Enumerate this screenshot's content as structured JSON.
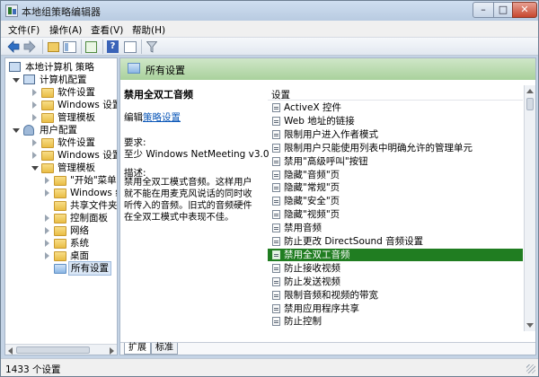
{
  "window": {
    "title": "本地组策略编辑器",
    "controls": {
      "minimize": "–",
      "maximize": "□",
      "close": "✕"
    }
  },
  "menubar": {
    "items": [
      "文件(F)",
      "操作(A)",
      "查看(V)",
      "帮助(H)"
    ]
  },
  "toolbar": {
    "icons": [
      "back-arrow-icon",
      "forward-arrow-icon",
      "up-folder-icon",
      "show-tree-icon",
      "export-list-icon",
      "help-icon",
      "properties-icon",
      "filter-icon"
    ],
    "help_glyph": "?"
  },
  "tree": {
    "root": "本地计算机 策略",
    "computer_config": "计算机配置",
    "computer_children": [
      "软件设置",
      "Windows 设置",
      "管理模板"
    ],
    "user_config": "用户配置",
    "user_children": [
      "软件设置",
      "Windows 设置",
      "管理模板"
    ],
    "admin_templates_children": [
      "\"开始\"菜单和",
      "Windows 组件",
      "共享文件夹",
      "控制面板",
      "网络",
      "系统",
      "桌面",
      "所有设置"
    ],
    "selected": "所有设置"
  },
  "right": {
    "header_title": "所有设置",
    "desc_title": "禁用全双工音频",
    "edit_prefix": "编辑",
    "edit_link": "策略设置",
    "requirements_label": "要求:",
    "requirements_value": "至少 Windows NetMeeting v3.0",
    "description_label": "描述:",
    "description_text": "禁用全双工模式音频。这样用户就不能在用麦克风说话的同时收听传入的音频。旧式的音频硬件在全双工模式中表现不佳。",
    "list_header": "设置",
    "settings": [
      "ActiveX 控件",
      "Web 地址的链接",
      "限制用户进入作者模式",
      "限制用户只能使用列表中明确允许的管理单元",
      "禁用\"高级呼叫\"按钮",
      "隐藏\"音频\"页",
      "隐藏\"常规\"页",
      "隐藏\"安全\"页",
      "隐藏\"视频\"页",
      "禁用音频",
      "防止更改 DirectSound 音频设置",
      "禁用全双工音频",
      "防止接收视频",
      "防止发送视频",
      "限制音频和视频的带宽",
      "禁用应用程序共享",
      "防止控制"
    ],
    "selected_setting_index": 11,
    "tabs": [
      "扩展",
      "标准"
    ],
    "accent_color": "#207d21"
  },
  "status": {
    "text": "1433 个设置"
  }
}
